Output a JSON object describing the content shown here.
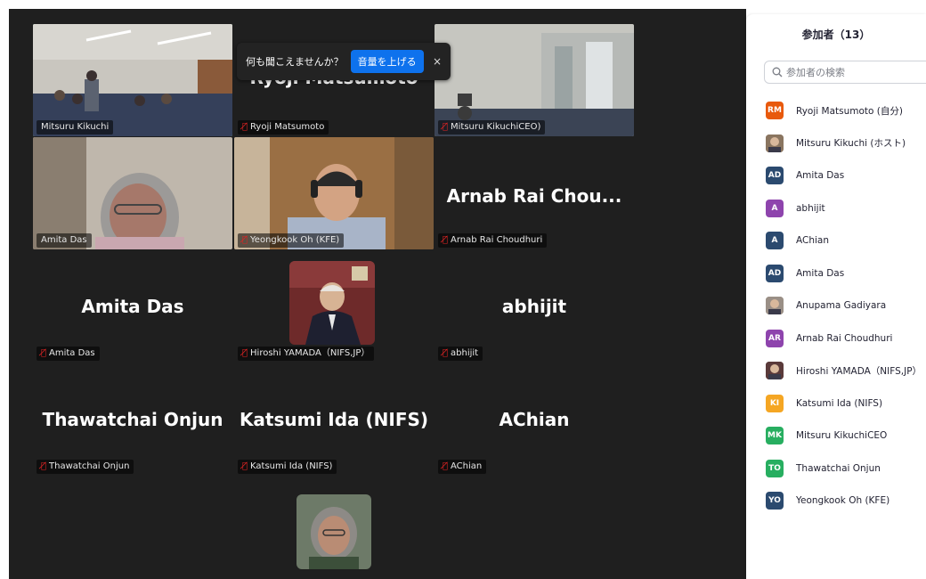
{
  "toast": {
    "message": "何も聞こえませんか？",
    "button": "音量を上げる",
    "close": "×"
  },
  "tiles": {
    "mitsuru_kikuchi": {
      "label": "Mitsuru Kikuchi"
    },
    "ryoji": {
      "name": "Ryoji Matsumoto",
      "label": "Ryoji Matsumoto"
    },
    "mitsuru_ceo": {
      "label": "Mitsuru KikuchiCEO)"
    },
    "amita_video": {
      "label": "Amita Das"
    },
    "yeongkook": {
      "label": "Yeongkook Oh (KFE)"
    },
    "arnab": {
      "name": "Arnab Rai Chou...",
      "label": "Arnab Rai Choudhuri"
    },
    "amita": {
      "name": "Amita Das",
      "label": "Amita Das"
    },
    "hiroshi": {
      "label": "Hiroshi YAMADA（NIFS,JP）"
    },
    "abhijit": {
      "name": "abhijit",
      "label": "abhijit"
    },
    "thawatchai": {
      "name": "Thawatchai Onjun",
      "label": "Thawatchai Onjun"
    },
    "katsumi": {
      "name": "Katsumi Ida (NIFS)",
      "label": "Katsumi Ida (NIFS)"
    },
    "achian": {
      "name": "AChian",
      "label": "AChian"
    }
  },
  "panel": {
    "title": "参加者（13）",
    "search_placeholder": "参加者の検索",
    "participants": [
      {
        "initials": "RM",
        "name": "Ryoji Matsumoto (自分)",
        "color": "#e8590c"
      },
      {
        "initials": "",
        "name": "Mitsuru Kikuchi (ホスト)",
        "color": "#8a7560"
      },
      {
        "initials": "AD",
        "name": "Amita Das",
        "color": "#2b4a6f"
      },
      {
        "initials": "A",
        "name": "abhijit",
        "color": "#8e44ad"
      },
      {
        "initials": "A",
        "name": "AChian",
        "color": "#2b4a6f"
      },
      {
        "initials": "AD",
        "name": "Amita Das",
        "color": "#2b4a6f"
      },
      {
        "initials": "",
        "name": "Anupama Gadiyara",
        "color": "#9a8f86"
      },
      {
        "initials": "AR",
        "name": "Arnab Rai Choudhuri",
        "color": "#8e44ad"
      },
      {
        "initials": "",
        "name": "Hiroshi YAMADA（NIFS,JP）",
        "color": "#5a3a3a"
      },
      {
        "initials": "KI",
        "name": "Katsumi Ida (NIFS)",
        "color": "#f5a623"
      },
      {
        "initials": "MK",
        "name": "Mitsuru KikuchiCEO",
        "color": "#27ae60"
      },
      {
        "initials": "TO",
        "name": "Thawatchai Onjun",
        "color": "#27ae60"
      },
      {
        "initials": "YO",
        "name": "Yeongkook Oh (KFE)",
        "color": "#2b4a6f"
      }
    ]
  }
}
